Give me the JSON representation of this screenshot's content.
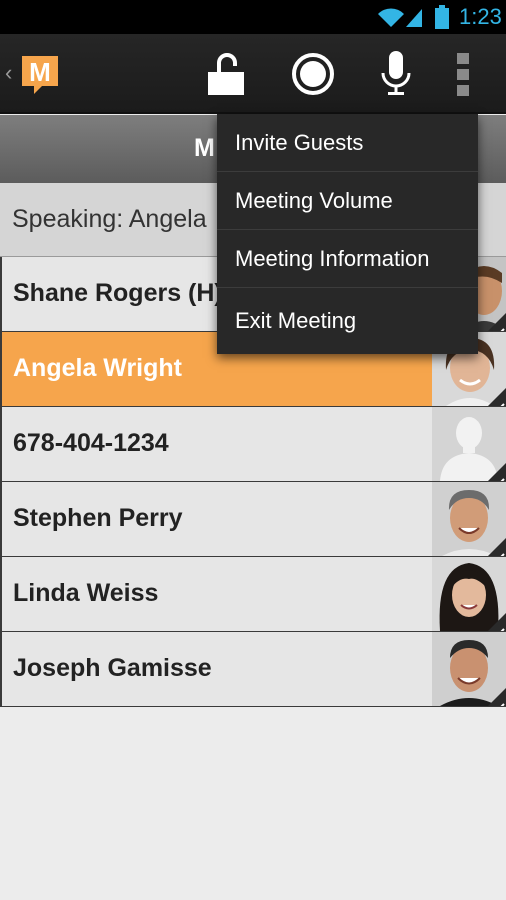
{
  "status_bar": {
    "time": "1:23",
    "icons": [
      "wifi-icon",
      "signal-icon",
      "battery-icon"
    ],
    "accent_color": "#33b5e5"
  },
  "action_bar": {
    "logo_letter": "M",
    "logo_color": "#f6a54c",
    "icons": [
      "lock-open-icon",
      "record-icon",
      "microphone-icon",
      "overflow-menu-icon"
    ]
  },
  "conference": {
    "title_visible": "M"
  },
  "speaking": {
    "text": "Speaking: Angela"
  },
  "participants": [
    {
      "name": "Shane Rogers (H)",
      "active": false,
      "avatar": "photo"
    },
    {
      "name": "Angela Wright",
      "active": true,
      "avatar": "photo"
    },
    {
      "name": "678-404-1234",
      "active": false,
      "avatar": "placeholder"
    },
    {
      "name": "Stephen Perry",
      "active": false,
      "avatar": "photo"
    },
    {
      "name": "Linda Weiss",
      "active": false,
      "avatar": "photo"
    },
    {
      "name": "Joseph Gamisse",
      "active": false,
      "avatar": "photo"
    }
  ],
  "overflow_menu": {
    "items": [
      {
        "label": "Invite Guests"
      },
      {
        "label": "Meeting Volume"
      },
      {
        "label": "Meeting Information"
      },
      {
        "label": "Exit Meeting"
      }
    ]
  },
  "colors": {
    "active_row": "#f6a54c",
    "row_bg": "#e6e6e6",
    "menu_bg": "#282828"
  }
}
